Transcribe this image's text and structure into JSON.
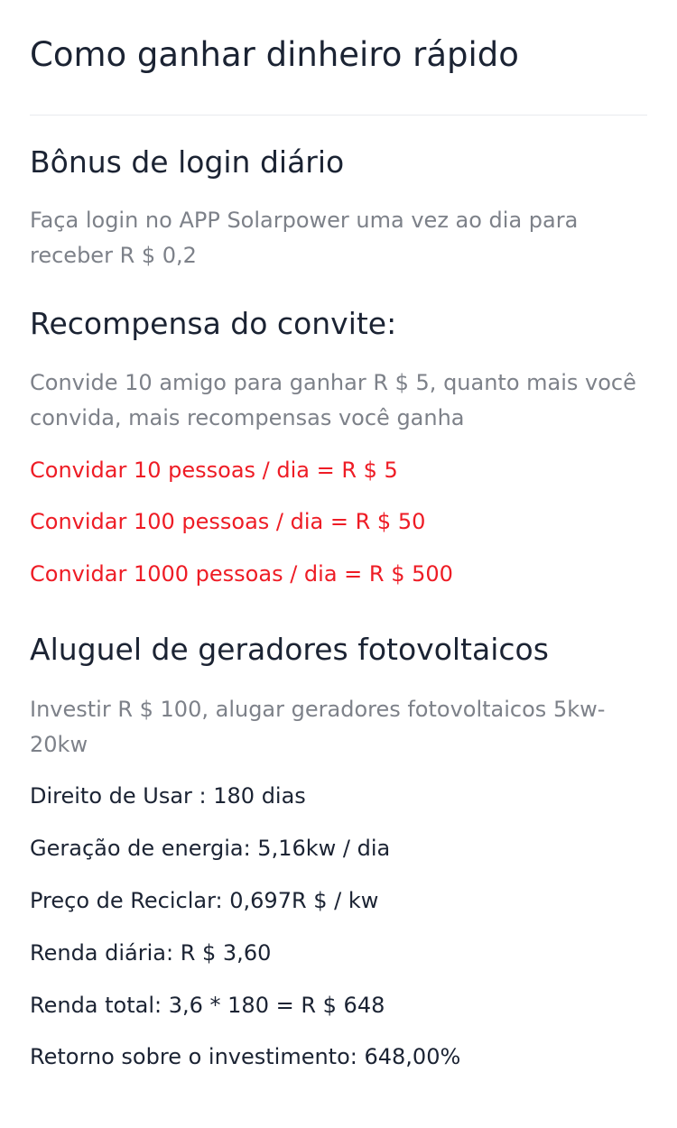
{
  "page": {
    "title": "Como ganhar dinheiro rápido"
  },
  "login_bonus": {
    "title": "Bônus de login diário",
    "description": "Faça login no APP Solarpower uma vez ao dia para receber R $ 0,2"
  },
  "invite_reward": {
    "title": "Recompensa do convite:",
    "description": "Convide 10 amigo para ganhar R $ 5, quanto mais você convida, mais recompensas você ganha",
    "tiers": [
      "Convidar 10 pessoas / dia = R $ 5",
      "Convidar 100 pessoas / dia = R $ 50",
      "Convidar 1000 pessoas / dia = R $ 500"
    ]
  },
  "generator_rental": {
    "title": "Aluguel de geradores fotovoltaicos",
    "description": "Investir R $ 100, alugar geradores fotovoltaicos 5kw-20kw",
    "details": [
      "Direito de Usar : 180 dias",
      "Geração de energia: 5,16kw / dia",
      "Preço de Reciclar: 0,697R $ / kw",
      "Renda diária: R $ 3,60",
      "Renda total: 3,6 * 180 = R $ 648",
      "Retorno sobre o investimento: 648,00%"
    ]
  },
  "colors": {
    "heading": "#1b2333",
    "description": "#7d8189",
    "highlight": "#ee1c25",
    "divider": "#e9ebee",
    "background": "#ffffff"
  }
}
